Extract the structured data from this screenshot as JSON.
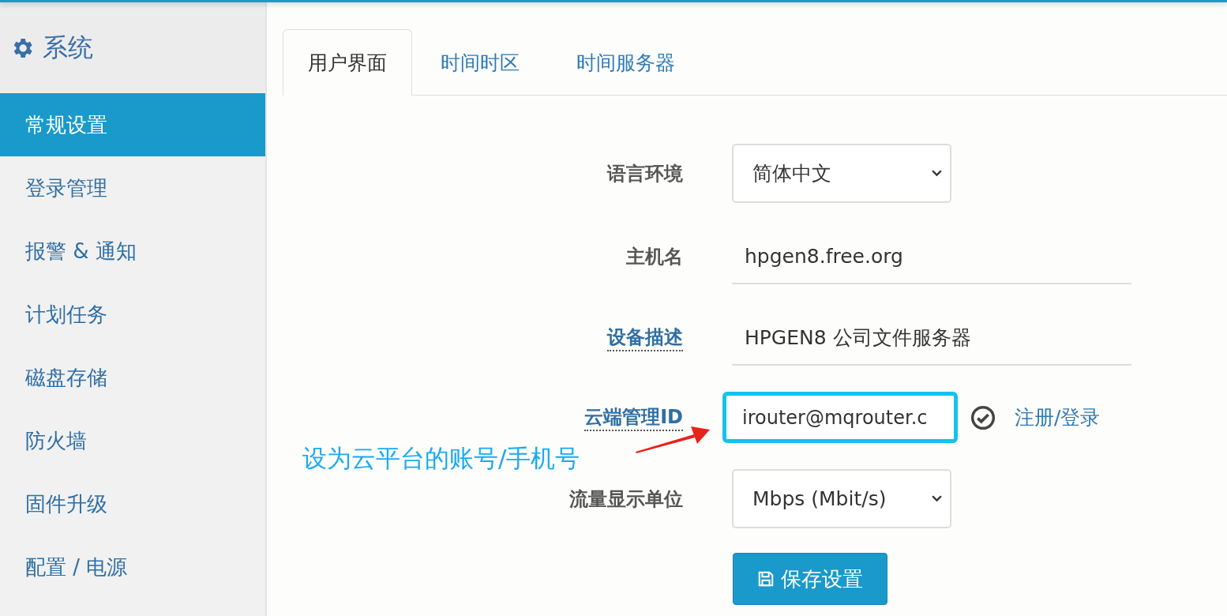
{
  "sidebar": {
    "title": "系统",
    "items": [
      {
        "label": "常规设置",
        "selected": true
      },
      {
        "label": "登录管理",
        "selected": false
      },
      {
        "label": "报警 & 通知",
        "selected": false
      },
      {
        "label": "计划任务",
        "selected": false
      },
      {
        "label": "磁盘存储",
        "selected": false
      },
      {
        "label": "防火墙",
        "selected": false
      },
      {
        "label": "固件升级",
        "selected": false
      },
      {
        "label": "配置 / 电源",
        "selected": false
      }
    ]
  },
  "tabs": [
    {
      "label": "用户界面",
      "selected": true
    },
    {
      "label": "时间时区",
      "selected": false
    },
    {
      "label": "时间服务器",
      "selected": false
    }
  ],
  "form": {
    "fields": [
      {
        "label": "语言环境",
        "has_tooltip": false,
        "kind": "select",
        "value": "简体中文"
      },
      {
        "label": "主机名",
        "has_tooltip": false,
        "kind": "text",
        "value": "hpgen8.free.org",
        "focused": false
      },
      {
        "label": "设备描述",
        "has_tooltip": true,
        "kind": "text",
        "value": "HPGEN8 公司文件服务器",
        "focused": false
      },
      {
        "label": "云端管理ID",
        "has_tooltip": true,
        "kind": "text",
        "value": "irouter@mqrouter.c",
        "focused": true,
        "link": "注册/登录"
      },
      {
        "label": "流量显示单位",
        "has_tooltip": false,
        "kind": "select",
        "value": "Mbps (Mbit/s)"
      }
    ],
    "save_button": "保存设置"
  },
  "annotation": "设为云平台的账号/手机号"
}
